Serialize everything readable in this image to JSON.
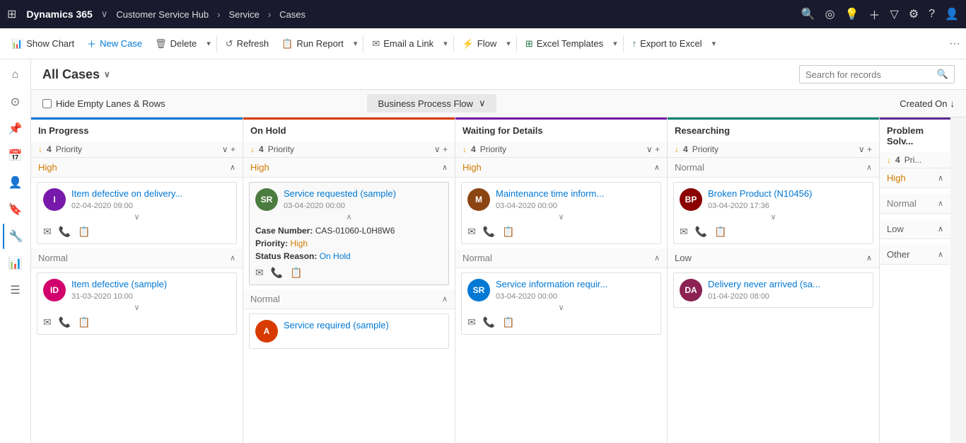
{
  "topnav": {
    "brand": "Dynamics 365",
    "app": "Customer Service Hub",
    "nav1": "Service",
    "sep": "›",
    "nav2": "Cases"
  },
  "commandbar": {
    "show_chart": "Show Chart",
    "new_case": "New Case",
    "delete": "Delete",
    "refresh": "Refresh",
    "run_report": "Run Report",
    "email_link": "Email a Link",
    "flow": "Flow",
    "excel_templates": "Excel Templates",
    "export_to_excel": "Export to Excel"
  },
  "view": {
    "title": "All Cases",
    "search_placeholder": "Search for records"
  },
  "kanban_controls": {
    "hide_empty": "Hide Empty Lanes & Rows",
    "bpf": "Business Process Flow",
    "created_on": "Created On"
  },
  "columns": [
    {
      "id": "in-progress",
      "title": "In Progress",
      "color": "blue",
      "sort_count": 4,
      "sort_label": "Priority",
      "groups": [
        {
          "label": "High",
          "priority": "high",
          "cards": [
            {
              "id": "I",
              "avatar_color": "#7719aa",
              "title": "Item defective on delivery...",
              "date": "02-04-2020 09:00",
              "expanded": false
            }
          ]
        },
        {
          "label": "Normal",
          "priority": "normal",
          "cards": [
            {
              "id": "ID",
              "avatar_color": "#d1006c",
              "title": "Item defective (sample)",
              "date": "31-03-2020 10:00",
              "expanded": false
            }
          ]
        }
      ]
    },
    {
      "id": "on-hold",
      "title": "On Hold",
      "color": "orange",
      "sort_count": 4,
      "sort_label": "Priority",
      "groups": [
        {
          "label": "High",
          "priority": "high",
          "cards": [
            {
              "id": "SR",
              "avatar_color": "#4a7c3f",
              "title": "Service requested (sample)",
              "date": "03-04-2020 00:00",
              "expanded": true,
              "case_number": "CAS-01060-L0H8W6",
              "priority": "High",
              "status_reason": "On Hold"
            }
          ]
        },
        {
          "label": "Normal",
          "priority": "normal",
          "cards": [
            {
              "id": "A",
              "avatar_color": "#d83b01",
              "title": "Service required (sample)",
              "date": "",
              "expanded": false
            }
          ]
        }
      ]
    },
    {
      "id": "waiting-for-details",
      "title": "Waiting for Details",
      "color": "purple",
      "sort_count": 4,
      "sort_label": "Priority",
      "groups": [
        {
          "label": "High",
          "priority": "high",
          "cards": [
            {
              "id": "M",
              "avatar_color": "#8b4513",
              "title": "Maintenance time inform...",
              "date": "03-04-2020 00:00",
              "expanded": false
            }
          ]
        },
        {
          "label": "Normal",
          "priority": "normal",
          "cards": [
            {
              "id": "SR",
              "avatar_color": "#0078d4",
              "title": "Service information requir...",
              "date": "03-04-2020 00:00",
              "expanded": false
            }
          ]
        }
      ]
    },
    {
      "id": "researching",
      "title": "Researching",
      "color": "teal",
      "sort_count": 4,
      "sort_label": "Priority",
      "groups": [
        {
          "label": "Normal",
          "priority": "normal",
          "cards": [
            {
              "id": "BP",
              "avatar_color": "#8b0000",
              "title": "Broken Product (N10456)",
              "date": "03-04-2020 17:36",
              "expanded": false
            }
          ]
        },
        {
          "label": "Low",
          "priority": "low",
          "cards": [
            {
              "id": "DA",
              "avatar_color": "#8b2252",
              "title": "Delivery never arrived (sa...",
              "date": "01-04-2020 08:00",
              "expanded": false
            }
          ]
        }
      ]
    },
    {
      "id": "problem-solving",
      "title": "Problem Solving",
      "color": "partial",
      "sort_count": 4,
      "sort_label": "Priority",
      "groups": [
        {
          "label": "High",
          "priority": "high",
          "cards": []
        },
        {
          "label": "Normal",
          "priority": "normal",
          "cards": []
        },
        {
          "label": "Low",
          "priority": "low",
          "cards": []
        },
        {
          "label": "Other",
          "priority": "other",
          "cards": []
        }
      ]
    }
  ]
}
